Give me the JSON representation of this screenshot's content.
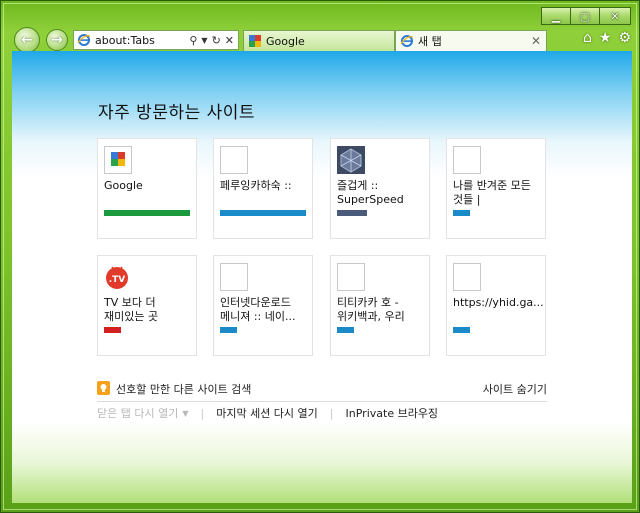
{
  "window": {
    "caption": {
      "minimize_icon": "minimize-icon",
      "maximize_icon": "maximize-icon",
      "close_icon": "close-icon"
    },
    "frame_color": "#6fb81e"
  },
  "nav": {
    "back_icon": "back-arrow-icon",
    "forward_icon": "forward-arrow-icon"
  },
  "address_bar": {
    "value": "about:Tabs",
    "search_icon": "search-icon",
    "dropdown_icon": "chevron-down-icon",
    "refresh_icon": "refresh-icon",
    "stop_icon": "stop-icon"
  },
  "tabs": [
    {
      "label": "Google",
      "icon": "google-favicon"
    },
    {
      "label": "새 탭",
      "icon": "ie-icon",
      "close": "✕"
    }
  ],
  "command_icons": [
    "home-icon",
    "favorites-star-icon",
    "tools-gear-icon"
  ],
  "content": {
    "title": "자주 방문하는 사이트",
    "tiles": [
      {
        "label": "Google",
        "icon": "google-favicon",
        "bar_color": "#1a9a3c",
        "bar_width": 1.0
      },
      {
        "label": "페루잉카하숙 ::",
        "icon": "blank-favicon",
        "bar_color": "#1a8ac8",
        "bar_width": 1.0
      },
      {
        "label": "즐겁게 :: SuperSpeed Ra...",
        "icon": "cube-favicon",
        "bar_color": "#4a5a7a",
        "bar_width": 0.35
      },
      {
        "label": "나를 반겨준 모든 것들 |",
        "icon": "blank-favicon",
        "bar_color": "#1a8ac8",
        "bar_width": 0.2
      },
      {
        "label": "TV 보다 더 재미있는 곳 WWW....",
        "icon": "tv-favicon",
        "bar_color": "#d42020",
        "bar_width": 0.2
      },
      {
        "label": "인터넷다운로드 메니져 :: 네이...",
        "icon": "blank-favicon",
        "bar_color": "#1a8ac8",
        "bar_width": 0.2
      },
      {
        "label": "티티카카 호 - 위키백과, 우리 모...",
        "icon": "blank-favicon",
        "bar_color": "#1a8ac8",
        "bar_width": 0.2
      },
      {
        "label": "https://yhid.ga...",
        "icon": "blank-favicon",
        "bar_color": "#1a8ac8",
        "bar_width": 0.2
      }
    ],
    "suggest_text": "선호할 만한 다른 사이트 검색",
    "hide_sites": "사이트 숨기기",
    "reopen_closed": "닫은 탭 다시 열기",
    "reopen_session": "마지막 세션 다시 열기",
    "inprivate": "InPrivate 브라우징"
  }
}
